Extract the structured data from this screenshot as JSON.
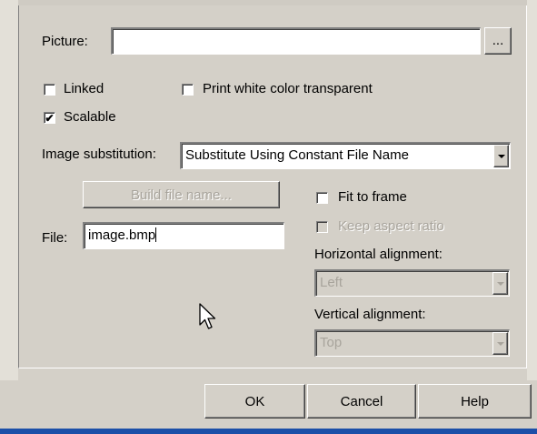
{
  "picture": {
    "label": "Picture:",
    "value": "",
    "browse_label": "..."
  },
  "options": {
    "linked": {
      "label": "Linked",
      "checked": false
    },
    "print_white_transparent": {
      "label": "Print white color transparent",
      "checked": false
    },
    "scalable": {
      "label": "Scalable",
      "checked": true,
      "mark": "✔"
    }
  },
  "image_substitution": {
    "label": "Image substitution:",
    "selected": "Substitute Using Constant File Name"
  },
  "build_file_name": {
    "label": "Build file name..."
  },
  "file": {
    "label": "File:",
    "value": "image.bmp"
  },
  "fit_to_frame": {
    "label": "Fit to frame",
    "checked": false
  },
  "keep_aspect_ratio": {
    "label": "Keep aspect ratio",
    "checked": false,
    "disabled": true
  },
  "horizontal_alignment": {
    "label": "Horizontal alignment:",
    "selected": "Left"
  },
  "vertical_alignment": {
    "label": "Vertical alignment:",
    "selected": "Top"
  },
  "footer": {
    "ok_label": "OK",
    "cancel_label": "Cancel",
    "help_label": "Help"
  },
  "colors": {
    "face": "#d4d0c8",
    "taskbar": "#1c4fa8",
    "disabled": "#a8a49c"
  }
}
